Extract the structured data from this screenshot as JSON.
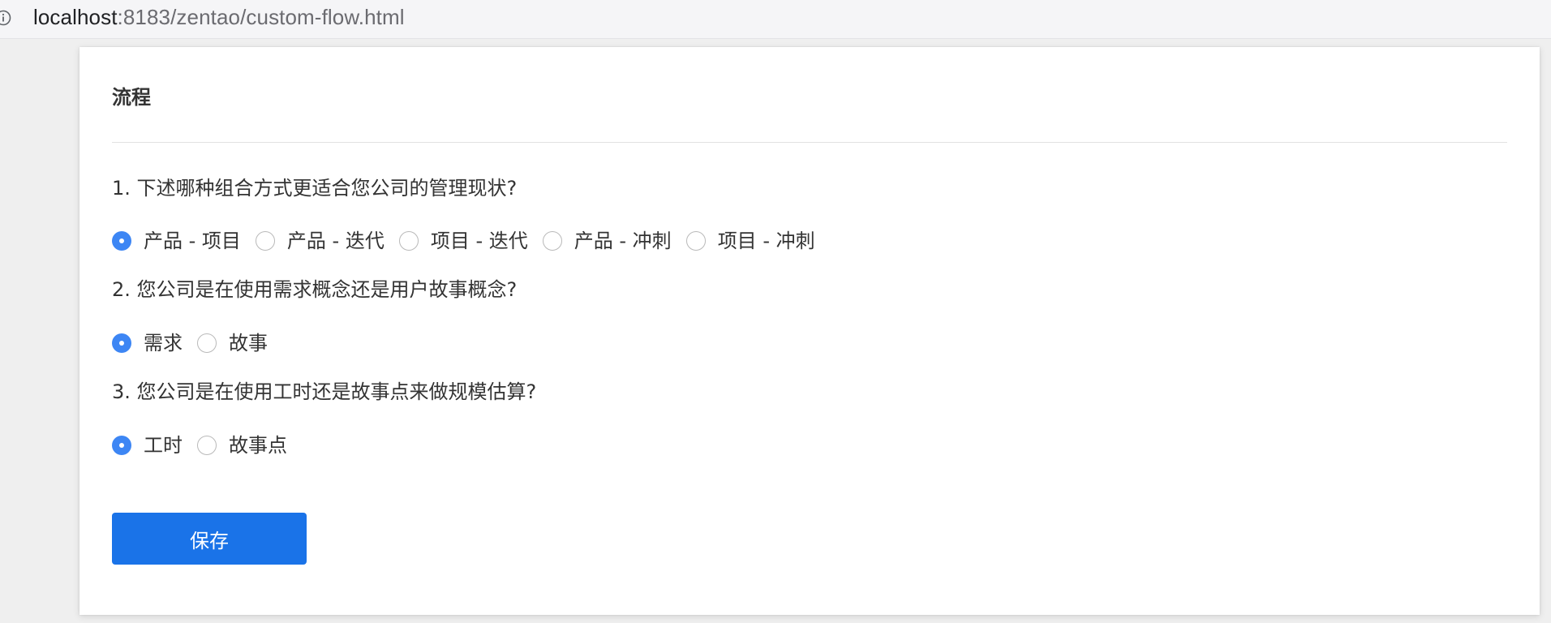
{
  "browser": {
    "url_host": "localhost",
    "url_rest": ":8183/zentao/custom-flow.html",
    "info_icon": "info-circle-icon"
  },
  "page": {
    "title": "流程",
    "save_label": "保存"
  },
  "questions": [
    {
      "text": "1. 下述哪种组合方式更适合您公司的管理现状?",
      "options": [
        {
          "label": "产品 - 项目",
          "checked": true
        },
        {
          "label": "产品 - 迭代",
          "checked": false
        },
        {
          "label": "项目 - 迭代",
          "checked": false
        },
        {
          "label": "产品 - 冲刺",
          "checked": false
        },
        {
          "label": "项目 - 冲刺",
          "checked": false
        }
      ]
    },
    {
      "text": "2. 您公司是在使用需求概念还是用户故事概念?",
      "options": [
        {
          "label": "需求",
          "checked": true
        },
        {
          "label": "故事",
          "checked": false
        }
      ]
    },
    {
      "text": "3. 您公司是在使用工时还是故事点来做规模估算?",
      "options": [
        {
          "label": "工时",
          "checked": true
        },
        {
          "label": "故事点",
          "checked": false
        }
      ]
    }
  ],
  "colors": {
    "accent": "#1a73e8",
    "radio_checked": "#3d86f4"
  }
}
